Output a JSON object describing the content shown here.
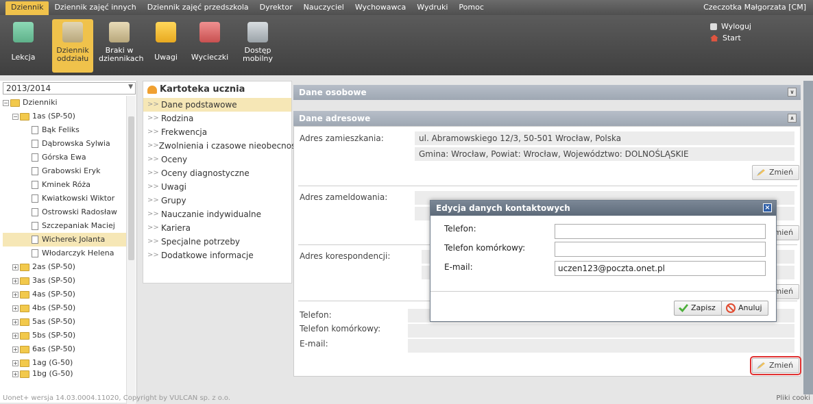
{
  "topmenu": {
    "items": [
      "Dziennik",
      "Dziennik zajęć innych",
      "Dziennik zajęć przedszkola",
      "Dyrektor",
      "Nauczyciel",
      "Wychowawca",
      "Wydruki",
      "Pomoc"
    ],
    "user": "Czeczotka Małgorzata [CM]"
  },
  "toolbar": {
    "lekcja": "Lekcja",
    "dziennik_oddzialu": [
      "Dziennik",
      "oddziału"
    ],
    "braki": [
      "Braki w",
      "dziennikach"
    ],
    "uwagi": "Uwagi",
    "wycieczki": "Wycieczki",
    "dostep": [
      "Dostęp",
      "mobilny"
    ],
    "logout": "Wyloguj",
    "start": "Start"
  },
  "tree": {
    "year": "2013/2014",
    "root": "Dzienniki",
    "class_open": "1as (SP-50)",
    "students": [
      "Bąk Feliks",
      "Dąbrowska Sylwia",
      "Górska Ewa",
      "Grabowski Eryk",
      "Kminek Róża",
      "Kwiatkowski Wiktor",
      "Ostrowski Radosław",
      "Szczepaniak Maciej",
      "Wicherek Jolanta",
      "Włodarczyk Helena"
    ],
    "classes": [
      "2as (SP-50)",
      "3as (SP-50)",
      "4as (SP-50)",
      "4bs (SP-50)",
      "5as (SP-50)",
      "5bs (SP-50)",
      "6as (SP-50)",
      "1ag (G-50)",
      "1bg (G-50)"
    ]
  },
  "kartoteka": {
    "title": "Kartoteka ucznia",
    "items": [
      "Dane podstawowe",
      "Rodzina",
      "Frekwencja",
      "Zwolnienia i czasowe nieobecności",
      "Oceny",
      "Oceny diagnostyczne",
      "Uwagi",
      "Grupy",
      "Nauczanie indywidualne",
      "Kariera",
      "Specjalne potrzeby",
      "Dodatkowe informacje"
    ]
  },
  "main": {
    "dane_osobowe": "Dane osobowe",
    "dane_adresowe": "Dane adresowe",
    "adres_zamieszkania_label": "Adres zamieszkania:",
    "adres_line1": "ul. Abramowskiego 12/3, 50-501 Wrocław, Polska",
    "adres_line2": "Gmina: Wrocław, Powiat: Wrocław, Województwo: DOLNOŚLĄSKIE",
    "adres_zameldowania_label": "Adres zameldowania:",
    "adres_korespondencji_label": "Adres korespondencji:",
    "telefon_label": "Telefon:",
    "telefon_kom_label": "Telefon komórkowy:",
    "email_label": "E-mail:",
    "zmien": "Zmień",
    "zmien_partial": "nień"
  },
  "modal": {
    "title": "Edycja danych kontaktowych",
    "telefon_label": "Telefon:",
    "telefon_kom_label": "Telefon komórkowy:",
    "email_label": "E-mail:",
    "telefon_value": "",
    "telefon_kom_value": "",
    "email_value": "uczen123@poczta.onet.pl",
    "save": "Zapisz",
    "cancel": "Anuluj"
  },
  "footer": {
    "version": "Uonet+ wersja 14.03.0004.11020, Copyright by VULCAN sp. z o.o.",
    "cookies": "Pliki cooki"
  }
}
